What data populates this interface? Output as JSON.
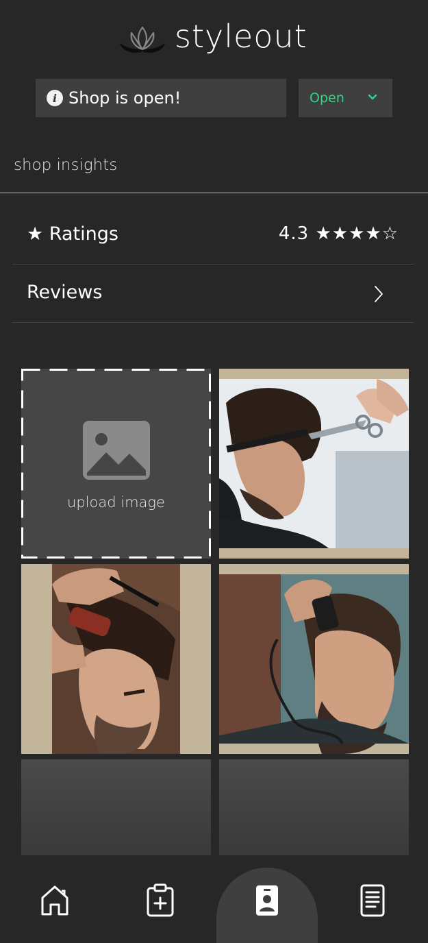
{
  "brand": {
    "name": "styleout",
    "logo_icon": "lotus-icon"
  },
  "status": {
    "message": "Shop is open!",
    "icon": "info-icon",
    "select_value": "Open",
    "accent": "#2ed48a"
  },
  "insights": {
    "title": "shop insights",
    "ratings": {
      "label": "★ Ratings",
      "value": "4.3 ★★★★☆",
      "rating": 4.3,
      "max": 5
    },
    "reviews": {
      "label": "Reviews"
    }
  },
  "gallery": {
    "upload_label": "upload image",
    "photos": [
      "barber-scissors-cut-photo",
      "barber-comb-clipper-photo",
      "barber-trimmer-photo"
    ]
  },
  "nav": {
    "items": [
      {
        "icon": "home-icon"
      },
      {
        "icon": "clipboard-add-icon"
      },
      {
        "icon": "profile-badge-icon",
        "active": true
      },
      {
        "icon": "document-list-icon"
      }
    ]
  },
  "colors": {
    "background": "#272727",
    "panel": "#3f3f3f",
    "accent": "#2ed48a"
  }
}
